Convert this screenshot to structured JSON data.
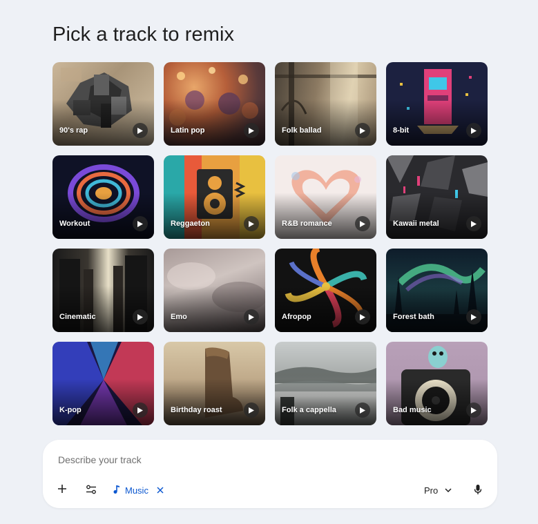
{
  "page_title": "Pick a track to remix",
  "tracks": [
    {
      "label": "90's rap"
    },
    {
      "label": "Latin pop"
    },
    {
      "label": "Folk ballad"
    },
    {
      "label": "8-bit"
    },
    {
      "label": "Workout"
    },
    {
      "label": "Reggaeton"
    },
    {
      "label": "R&B romance"
    },
    {
      "label": "Kawaii metal"
    },
    {
      "label": "Cinematic"
    },
    {
      "label": "Emo"
    },
    {
      "label": "Afropop"
    },
    {
      "label": "Forest bath"
    },
    {
      "label": "K-pop"
    },
    {
      "label": "Birthday roast"
    },
    {
      "label": "Folk a cappella"
    },
    {
      "label": "Bad music"
    }
  ],
  "composer": {
    "placeholder": "Describe your track",
    "chip_label": "Music",
    "model_label": "Pro"
  },
  "colors": {
    "accent": "#0b57d0",
    "background": "#eef1f6"
  }
}
